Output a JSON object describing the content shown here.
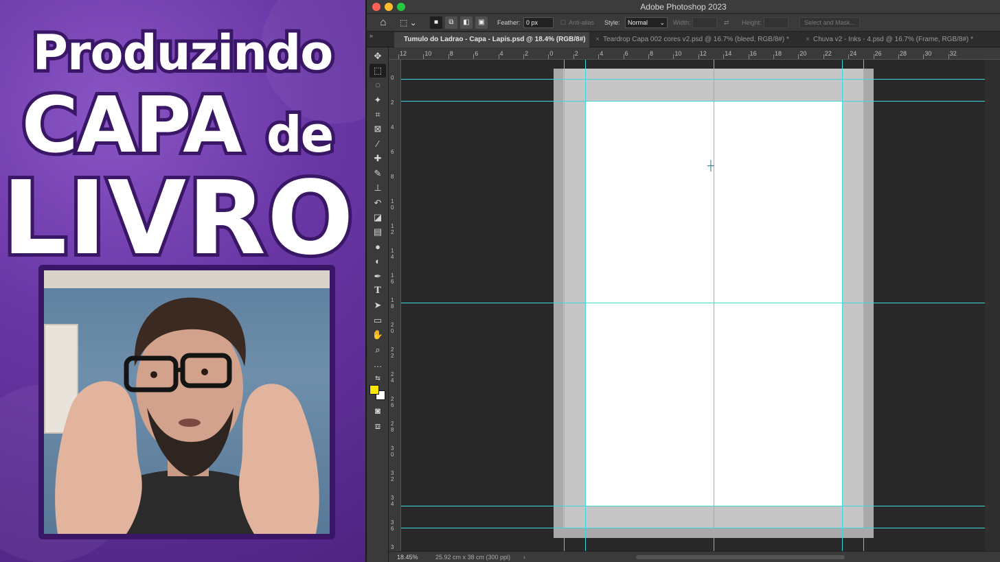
{
  "promo": {
    "line1": "Produzindo",
    "line2_main": "CAPA",
    "line2_suffix": "de",
    "line3": "LIVRO"
  },
  "app": {
    "title": "Adobe Photoshop 2023"
  },
  "options_bar": {
    "feather_label": "Feather:",
    "feather_value": "0 px",
    "antialias_label": "Anti-alias",
    "style_label": "Style:",
    "style_value": "Normal",
    "width_label": "Width:",
    "height_label": "Height:",
    "select_mask_label": "Select and Mask..."
  },
  "tabs": [
    {
      "label": "Tumulo do Ladrao - Capa - Lapis.psd @ 18.4% (RGB/8#)",
      "active": true
    },
    {
      "label": "Teardrop Capa 002 cores v2.psd @ 16.7% (bleed, RGB/8#) *",
      "active": false
    },
    {
      "label": "Chuva v2 - Inks - 4.psd @ 16.7% (Frame, RGB/8#) *",
      "active": false
    }
  ],
  "ruler_top_labels": [
    "12",
    "10",
    "8",
    "6",
    "4",
    "2",
    "0",
    "2",
    "4",
    "6",
    "8",
    "10",
    "12",
    "14",
    "16",
    "18",
    "20",
    "22",
    "24",
    "26",
    "28",
    "30",
    "32"
  ],
  "ruler_left_labels": [
    "0",
    "2",
    "4",
    "6",
    "8",
    "1 0",
    "1 2",
    "1 4",
    "1 6",
    "1 8",
    "2 0",
    "2 2",
    "2 4",
    "2 6",
    "2 8",
    "3 0",
    "3 2",
    "3 4",
    "3 6",
    "3 8"
  ],
  "status": {
    "zoom": "18.45%",
    "doc_size": "25.92 cm x 38 cm (300 ppi)",
    "arrow": "›"
  },
  "colors": {
    "foreground": "#ffe600",
    "background": "#ffffff",
    "guides": "#39d8de",
    "promo_purple": "#6a37a6"
  },
  "tools": [
    "move-icon",
    "rect-marquee-icon",
    "lasso-icon",
    "magic-wand-icon",
    "crop-icon",
    "frame-icon",
    "eyedropper-icon",
    "healing-brush-icon",
    "brush-icon",
    "clone-stamp-icon",
    "history-brush-icon",
    "eraser-icon",
    "gradient-icon",
    "blur-icon",
    "dodge-icon",
    "pen-icon",
    "type-icon",
    "path-select-icon",
    "rectangle-icon",
    "hand-icon",
    "zoom-icon",
    "more-tools-icon"
  ]
}
